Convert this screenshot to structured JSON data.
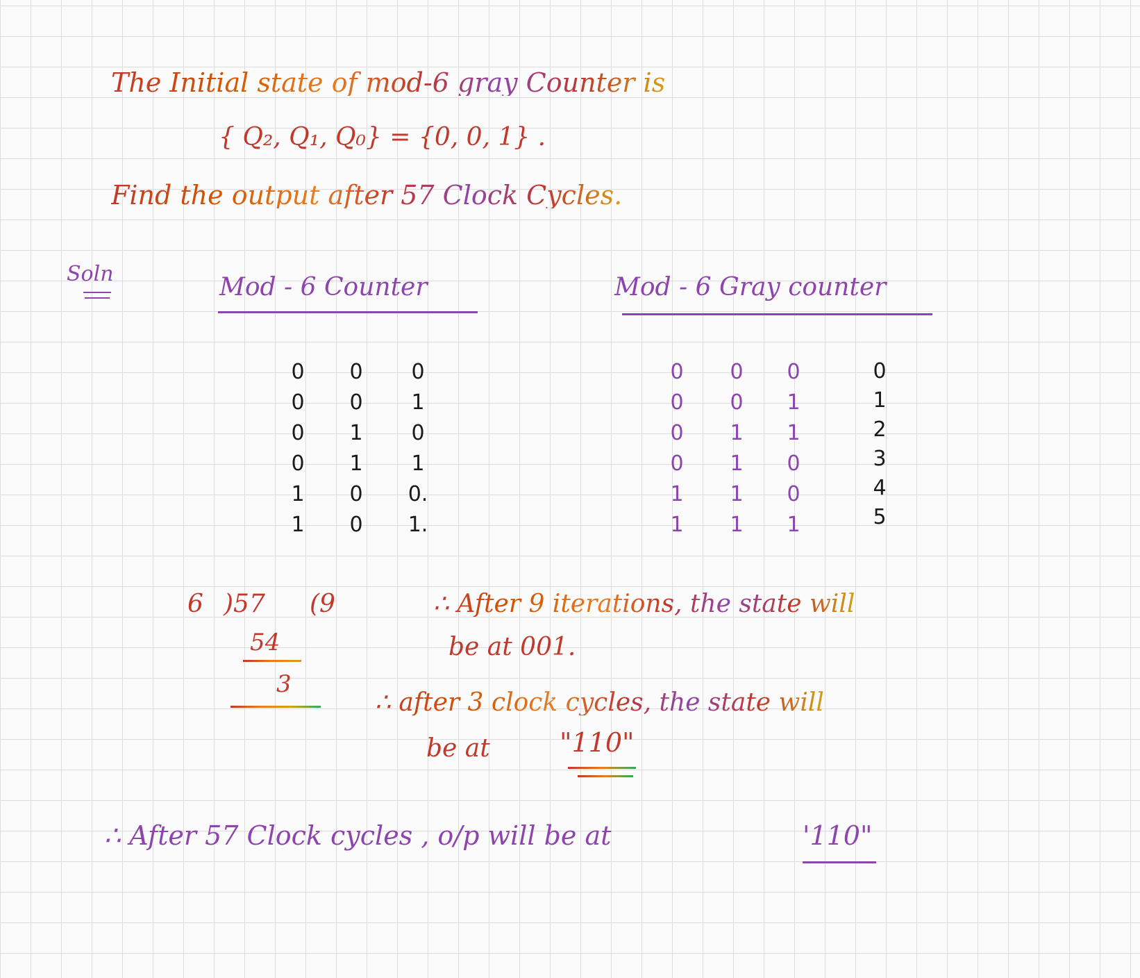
{
  "question": {
    "line1": "The  Initial state of  mod-6 gray Counter  is",
    "line2": "{ Q₂, Q₁, Q₀}  =  {0, 0, 1} .",
    "line3": "Find  the  output  after  57  Clock  Cycles."
  },
  "solution_label": "Soln",
  "table_left": {
    "title": "Mod - 6  Counter",
    "columns": [
      [
        "0",
        "0",
        "0",
        "0",
        "1",
        "1"
      ],
      [
        "0",
        "0",
        "1",
        "1",
        "0",
        "0"
      ],
      [
        "0",
        "1",
        "0",
        "1",
        "0.",
        "1."
      ]
    ]
  },
  "table_right": {
    "title": "Mod - 6  Gray counter",
    "columns": [
      [
        "0",
        "0",
        "0",
        "0",
        "1",
        "1"
      ],
      [
        "0",
        "0",
        "1",
        "1",
        "1",
        "1"
      ],
      [
        "0",
        "1",
        "1",
        "0",
        "0",
        "1"
      ]
    ],
    "index": [
      "0",
      "1",
      "2",
      "3",
      "4",
      "5"
    ]
  },
  "division": {
    "divisor": "6",
    "dividend": ")57",
    "quotient": "(9",
    "product": "54",
    "remainder": "3"
  },
  "explanation": {
    "line1": "∴ After  9 iterations,  the  state  will",
    "line2": "be  at  001.",
    "line3": "∴  after 3  clock cycles,  the  state  will",
    "line4_prefix": "be  at",
    "line4_value": "\"110\""
  },
  "conclusion": {
    "text": "∴  After  57  Clock  cycles ,  o/p will  be  at",
    "value": "'110\""
  },
  "colors": {
    "red": "#c0392b",
    "purple": "#8e44ad",
    "black": "#1a1a1a",
    "grid": "#dddddd"
  }
}
